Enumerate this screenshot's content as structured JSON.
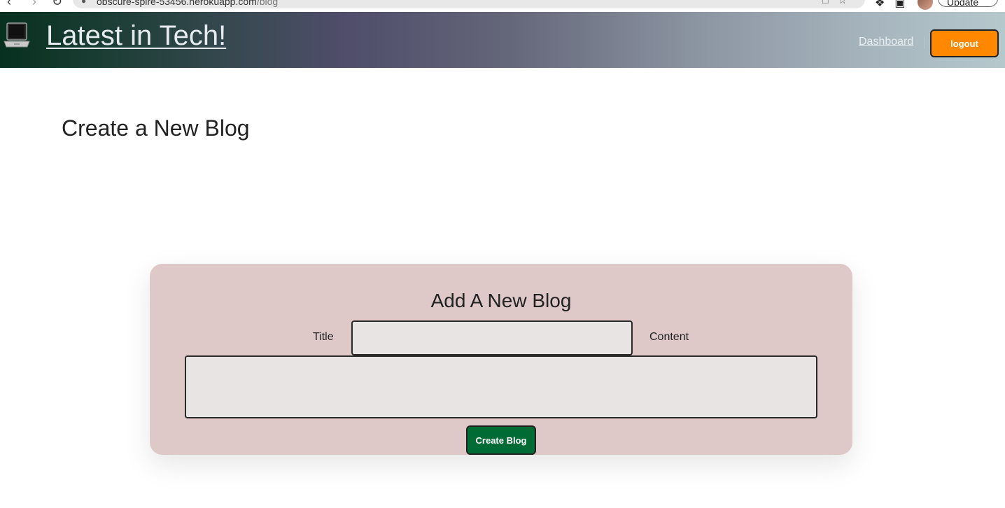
{
  "browser": {
    "back_glyph": "‹",
    "forward_glyph": "›",
    "reload_glyph": "↻",
    "url_host": "obscure-spire-53456.herokuapp.com",
    "url_path": "/blog",
    "update_label": "Update"
  },
  "header": {
    "logo_icon": "laptop-icon",
    "title": "Latest in Tech!",
    "nav_dashboard": "Dashboard",
    "logout_label": "logout",
    "colors": {
      "logout_bg": "#ff8800",
      "gradient_start": "#07301f",
      "gradient_mid": "#4f4d6a",
      "gradient_end": "#b5c8cc"
    }
  },
  "main": {
    "page_heading": "Create a New Blog"
  },
  "form": {
    "heading": "Add A New Blog",
    "title_label": "Title",
    "title_value": "",
    "content_label": "Content",
    "content_value": "",
    "submit_label": "Create Blog",
    "colors": {
      "card_bg": "#dec8c8",
      "submit_bg": "#006b35",
      "input_bg": "#e8e4e4"
    }
  }
}
